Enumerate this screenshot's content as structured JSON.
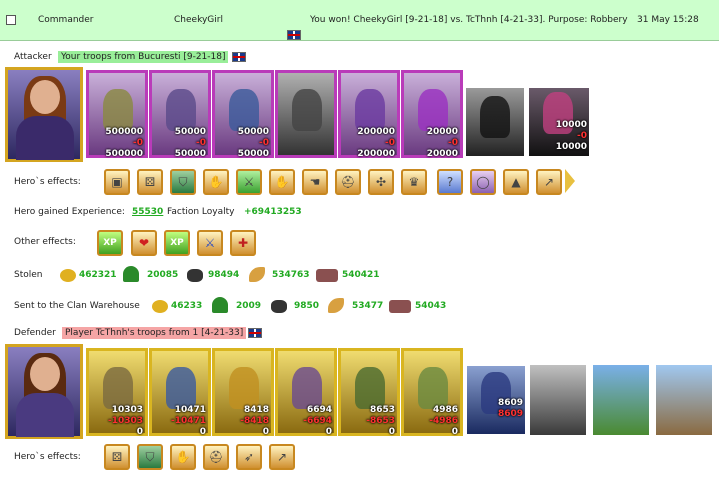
{
  "header": {
    "sender": "Commander",
    "player": "CheekyGirl",
    "message": "You won! CheekyGirl [9-21-18] vs. TcThnh [4-21-33]. Purpose: Robbery",
    "date": "31 May 15:28"
  },
  "attacker": {
    "label": "Attacker",
    "troops_tag": "Your troops from Bucuresti [9-21-18]",
    "units": [
      {
        "top": "500000",
        "mid": "-0",
        "bot": "500000"
      },
      {
        "top": "50000",
        "mid": "-0",
        "bot": "50000"
      },
      {
        "top": "50000",
        "mid": "-0",
        "bot": "50000"
      },
      {
        "top": "",
        "mid": "",
        "bot": ""
      },
      {
        "top": "200000",
        "mid": "-0",
        "bot": "200000"
      },
      {
        "top": "20000",
        "mid": "-0",
        "bot": "20000"
      },
      {
        "top": "",
        "mid": "",
        "bot": ""
      },
      {
        "top": "10000",
        "mid": "-0",
        "bot": "10000"
      }
    ],
    "effects_label": "Hero`s effects:",
    "effects": [
      "chest-icon",
      "dice-icon",
      "shield-icon",
      "handshake-icon",
      "sword-icon",
      "handshake-icon",
      "glove-icon",
      "helmet-icon",
      "crosshair-icon",
      "crown-icon",
      "question-icon",
      "ring-icon",
      "tent-icon",
      "spear-icon"
    ]
  },
  "experience": {
    "label": "Hero gained Experience:",
    "value": "55530",
    "loyalty_label": "Faction Loyalty",
    "loyalty_value": "+69413253"
  },
  "other_effects": {
    "label": "Other effects:",
    "effects": [
      {
        "icon": "xp-icon",
        "text": "XP"
      },
      {
        "icon": "heart-icon",
        "text": "❤"
      },
      {
        "icon": "xp-icon",
        "text": "XP"
      },
      {
        "icon": "sword-icon",
        "text": "⚔"
      },
      {
        "icon": "axe-icon",
        "text": "✚"
      }
    ]
  },
  "stolen": {
    "label": "Stolen",
    "items": [
      {
        "icon": "gold-icon",
        "value": "462321"
      },
      {
        "icon": "wood-icon",
        "value": "20085"
      },
      {
        "icon": "ore-icon",
        "value": "98494"
      },
      {
        "icon": "grain-icon",
        "value": "534763"
      },
      {
        "icon": "stone-icon",
        "value": "540421"
      }
    ]
  },
  "clan": {
    "label": "Sent to the Clan Warehouse",
    "items": [
      {
        "icon": "gold-icon",
        "value": "46233"
      },
      {
        "icon": "wood-icon",
        "value": "2009"
      },
      {
        "icon": "ore-icon",
        "value": "9850"
      },
      {
        "icon": "grain-icon",
        "value": "53477"
      },
      {
        "icon": "stone-icon",
        "value": "54043"
      }
    ]
  },
  "defender": {
    "label": "Defender",
    "troops_tag": "Player TcThnh's troops from 1 [4-21-33]",
    "units": [
      {
        "top": "10303",
        "mid": "-10303",
        "bot": "0"
      },
      {
        "top": "10471",
        "mid": "-10471",
        "bot": "0"
      },
      {
        "top": "8418",
        "mid": "-8418",
        "bot": "0"
      },
      {
        "top": "6694",
        "mid": "-6694",
        "bot": "0"
      },
      {
        "top": "8653",
        "mid": "-8653",
        "bot": "0"
      },
      {
        "top": "4986",
        "mid": "-4986",
        "bot": "0"
      },
      {
        "top": "8609",
        "mid": "8609",
        "bot": ""
      }
    ],
    "effects_label": "Hero`s effects:",
    "effects": [
      "dice-icon",
      "shield-icon",
      "handshake-icon",
      "helmet-icon",
      "bow-icon",
      "spear-icon"
    ]
  },
  "colors": {
    "header_bg": "#ccffcc",
    "attacker_tag": "#99ee99",
    "defender_tag": "#f5a5a5",
    "value_green": "#22aa22"
  }
}
